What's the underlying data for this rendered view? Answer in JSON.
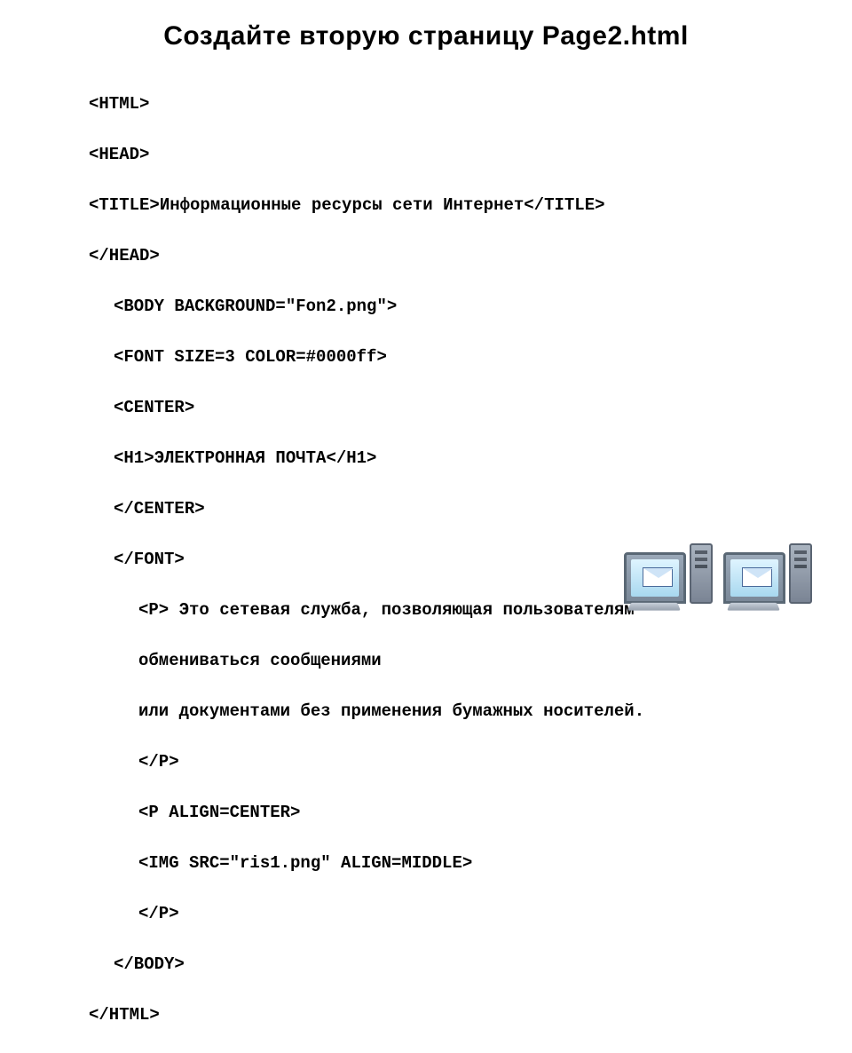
{
  "title": "Создайте вторую страницу Page2.html",
  "code": {
    "l1": "<HTML>",
    "l2": "<HEAD>",
    "l3": "<TITLE>Информационные ресурсы сети Интернет</TITLE>",
    "l4": "</HEAD>",
    "l5": "<BODY BACKGROUND=\"Fon2.png\">",
    "l6": "<FONT SIZE=3 COLOR=#0000ff>",
    "l7": "<CENTER>",
    "l8": "<H1>ЭЛЕКТРОННАЯ ПОЧТА</H1>",
    "l9": "</CENTER>",
    "l10": "</FONT>",
    "l11": "<P> Это сетевая служба, позволяющая пользователям",
    "l12": "обмениваться сообщениями",
    "l13": "или документами без применения бумажных носителей.",
    "l14": "</P>",
    "l15": "<P ALIGN=CENTER>",
    "l16": "<IMG SRC=\"ris1.png\" ALIGN=MIDDLE>",
    "l17": "</P>",
    "l18": "</BODY>",
    "l19": "</HTML>"
  }
}
